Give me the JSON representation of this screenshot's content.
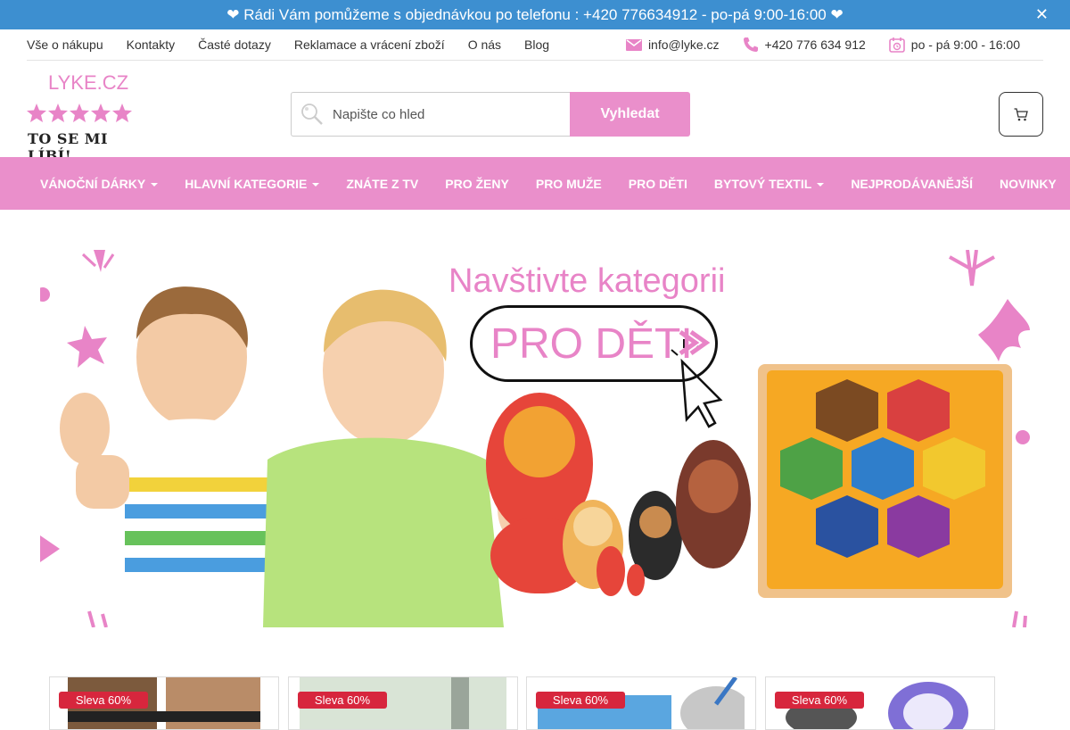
{
  "announcement": {
    "text": "❤ Rádi Vám pomůžeme s objednávkou po telefonu : +420 776634912 - po-pá 9:00-16:00 ❤",
    "close_icon": "✕"
  },
  "topbar": {
    "links": [
      "Vše o nákupu",
      "Kontakty",
      "Časté dotazy",
      "Reklamace a vrácení zboží",
      "O nás",
      "Blog"
    ],
    "email": "info@lyke.cz",
    "phone": "+420 776 634 912",
    "hours": "po - pá 9:00 - 16:00"
  },
  "logo": {
    "name": "LYKE.CZ",
    "tagline": "TO SE MI LÍBÍ!"
  },
  "search": {
    "placeholder": "Napište co hled",
    "button_label": "Vyhledat"
  },
  "nav": {
    "items": [
      {
        "label": "VÁNOČNÍ DÁRKY",
        "dropdown": true
      },
      {
        "label": "HLAVNÍ KATEGORIE",
        "dropdown": true
      },
      {
        "label": "ZNÁTE Z TV",
        "dropdown": false
      },
      {
        "label": "PRO ŽENY",
        "dropdown": false
      },
      {
        "label": "PRO MUŽE",
        "dropdown": false
      },
      {
        "label": "PRO DĚTI",
        "dropdown": false
      },
      {
        "label": "BYTOVÝ TEXTIL",
        "dropdown": true
      },
      {
        "label": "NEJPRODÁVANĚJŠÍ",
        "dropdown": false
      },
      {
        "label": "NOVINKY",
        "dropdown": false
      }
    ]
  },
  "banner": {
    "headline": "Navštivte kategorii",
    "cta": "PRO DĚTI"
  },
  "products": [
    {
      "badge": "Sleva 60%"
    },
    {
      "badge": "Sleva 60%"
    },
    {
      "badge": "Sleva 60%"
    },
    {
      "badge": "Sleva 60%"
    }
  ],
  "colors": {
    "announcement_bg": "#3d8fd0",
    "brand_pink": "#ea8fcb",
    "sale_red": "#d7263d"
  }
}
